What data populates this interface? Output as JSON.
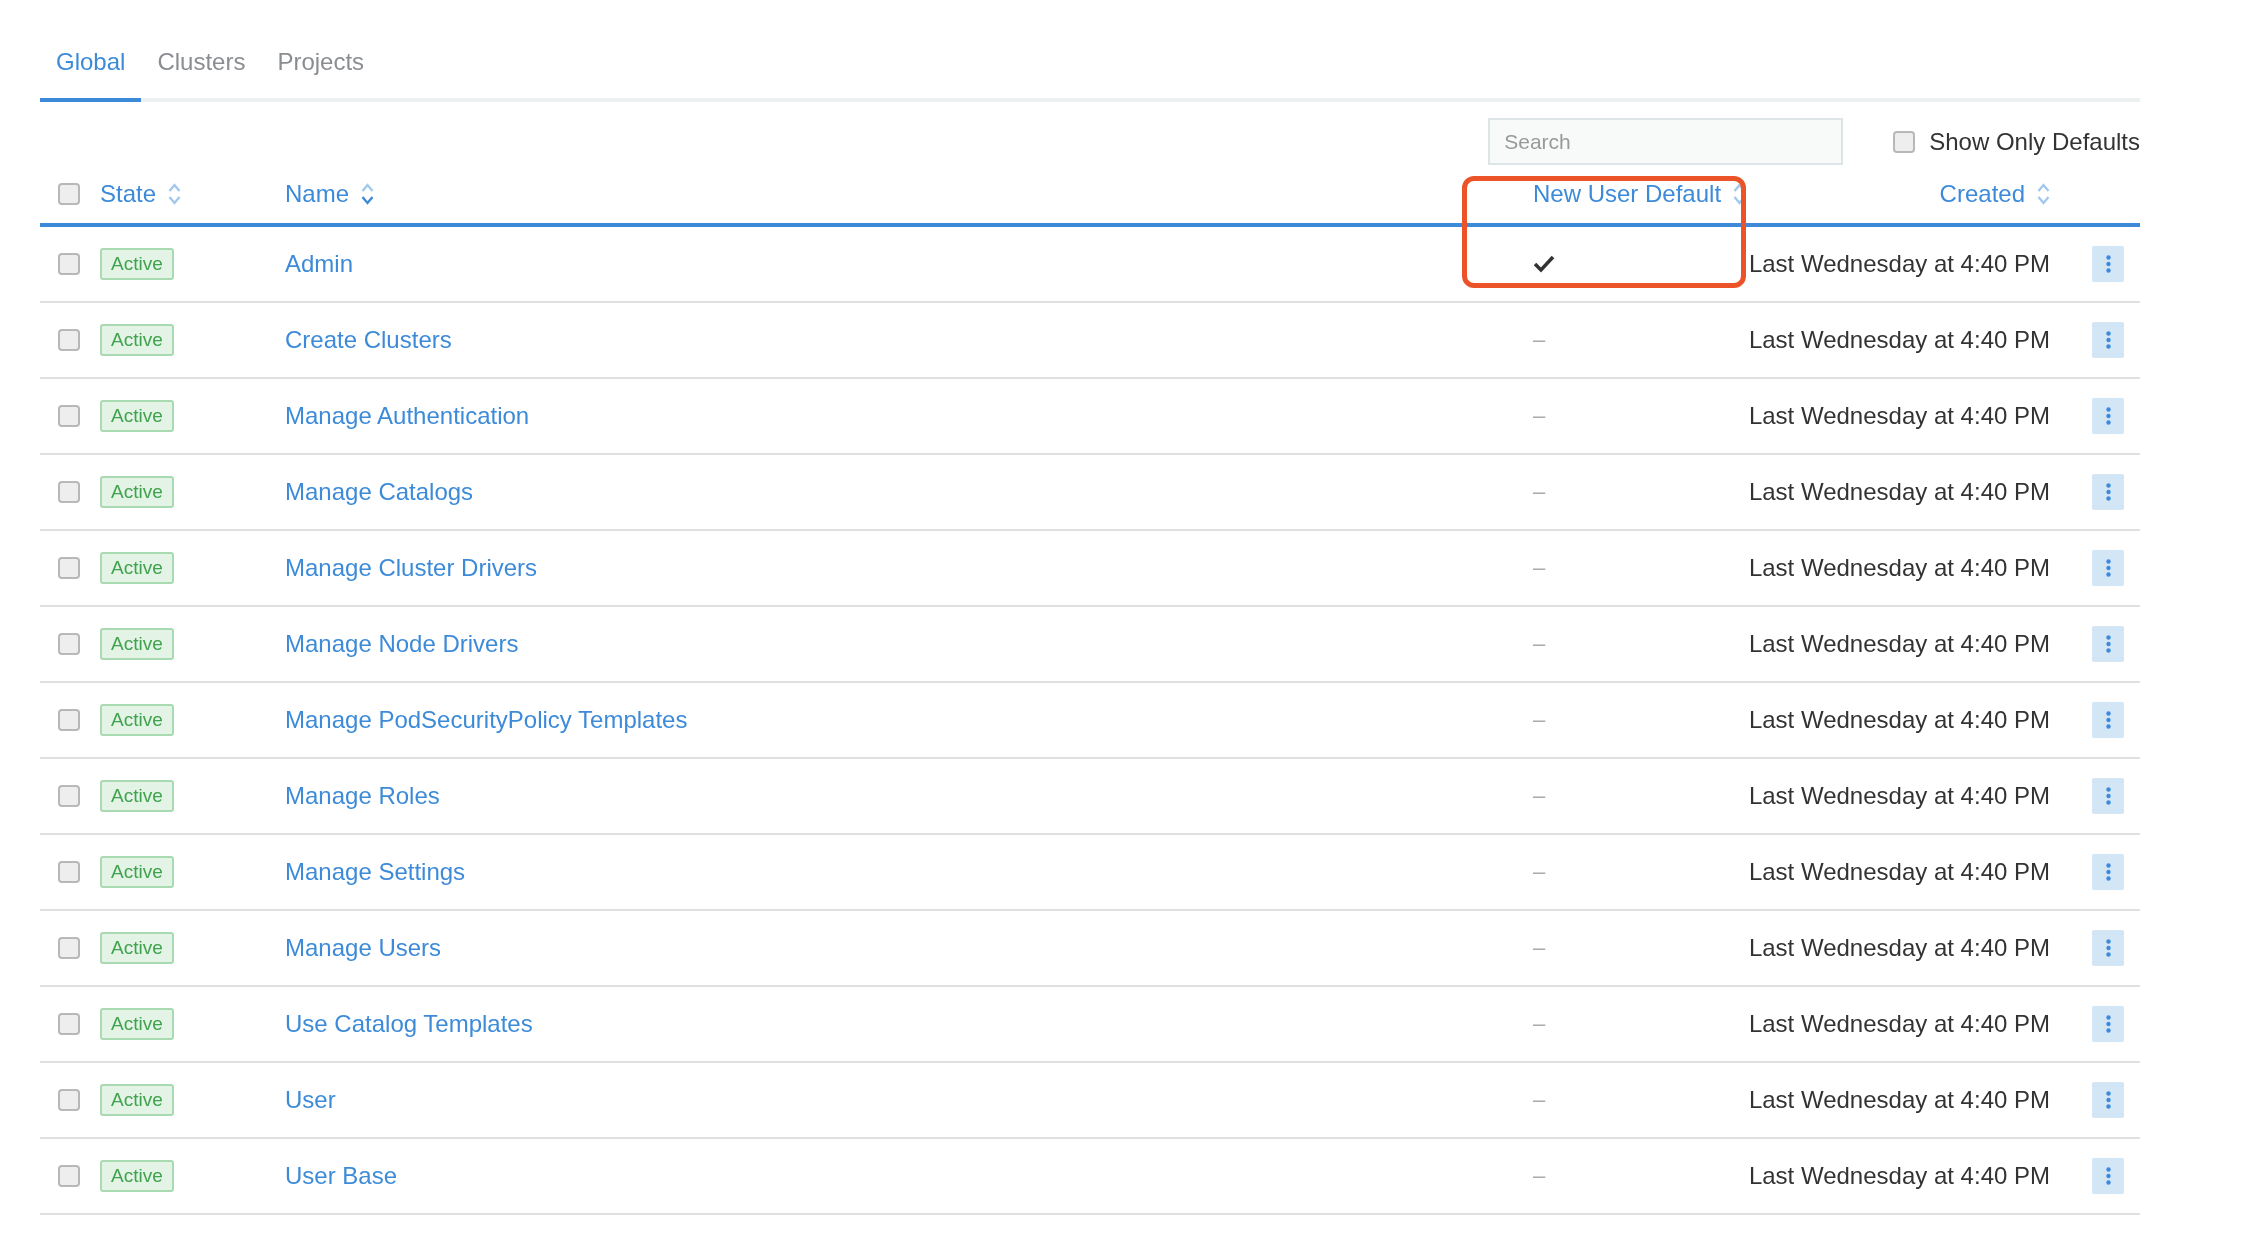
{
  "tabs": [
    {
      "label": "Global",
      "selected": true
    },
    {
      "label": "Clusters",
      "selected": false
    },
    {
      "label": "Projects",
      "selected": false
    }
  ],
  "search": {
    "placeholder": "Search"
  },
  "show_only_defaults": {
    "label": "Show Only Defaults",
    "checked": false
  },
  "table": {
    "select_all_checked": false,
    "columns": [
      {
        "label": "State",
        "sorted": false,
        "highlighted": false
      },
      {
        "label": "Name",
        "sorted": true,
        "highlighted": false
      },
      {
        "label": "New User Default",
        "sorted": false,
        "highlighted": true
      },
      {
        "label": "Created",
        "sorted": false,
        "highlighted": false
      }
    ],
    "rows": [
      {
        "checked": false,
        "state": "Active",
        "name": "Admin",
        "default": true,
        "created": "Last Wednesday at 4:40 PM"
      },
      {
        "checked": false,
        "state": "Active",
        "name": "Create Clusters",
        "default": false,
        "default_text": "–",
        "created": "Last Wednesday at 4:40 PM"
      },
      {
        "checked": false,
        "state": "Active",
        "name": "Manage Authentication",
        "default": false,
        "default_text": "–",
        "created": "Last Wednesday at 4:40 PM"
      },
      {
        "checked": false,
        "state": "Active",
        "name": "Manage Catalogs",
        "default": false,
        "default_text": "–",
        "created": "Last Wednesday at 4:40 PM"
      },
      {
        "checked": false,
        "state": "Active",
        "name": "Manage Cluster Drivers",
        "default": false,
        "default_text": "–",
        "created": "Last Wednesday at 4:40 PM"
      },
      {
        "checked": false,
        "state": "Active",
        "name": "Manage Node Drivers",
        "default": false,
        "default_text": "–",
        "created": "Last Wednesday at 4:40 PM"
      },
      {
        "checked": false,
        "state": "Active",
        "name": "Manage PodSecurityPolicy Templates",
        "default": false,
        "default_text": "–",
        "created": "Last Wednesday at 4:40 PM"
      },
      {
        "checked": false,
        "state": "Active",
        "name": "Manage Roles",
        "default": false,
        "default_text": "–",
        "created": "Last Wednesday at 4:40 PM"
      },
      {
        "checked": false,
        "state": "Active",
        "name": "Manage Settings",
        "default": false,
        "default_text": "–",
        "created": "Last Wednesday at 4:40 PM"
      },
      {
        "checked": false,
        "state": "Active",
        "name": "Manage Users",
        "default": false,
        "default_text": "–",
        "created": "Last Wednesday at 4:40 PM"
      },
      {
        "checked": false,
        "state": "Active",
        "name": "Use Catalog Templates",
        "default": false,
        "default_text": "–",
        "created": "Last Wednesday at 4:40 PM"
      },
      {
        "checked": false,
        "state": "Active",
        "name": "User",
        "default": false,
        "default_text": "–",
        "created": "Last Wednesday at 4:40 PM"
      },
      {
        "checked": false,
        "state": "Active",
        "name": "User Base",
        "default": false,
        "default_text": "–",
        "created": "Last Wednesday at 4:40 PM"
      }
    ]
  }
}
